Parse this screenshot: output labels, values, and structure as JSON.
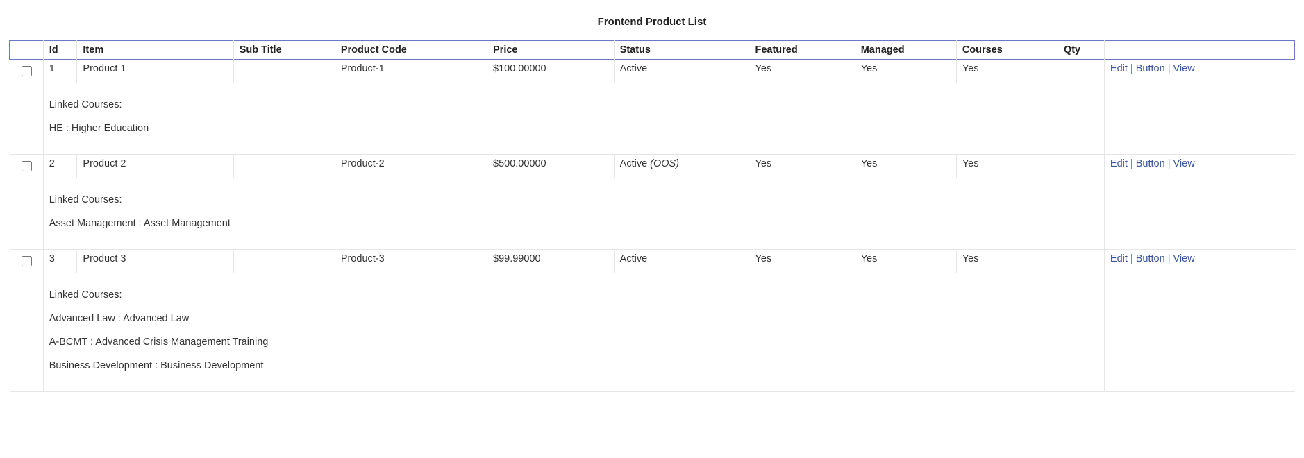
{
  "title": "Frontend Product List",
  "columns": {
    "checkbox": "",
    "id": "Id",
    "item": "Item",
    "sub_title": "Sub Title",
    "product_code": "Product Code",
    "price": "Price",
    "status": "Status",
    "featured": "Featured",
    "managed": "Managed",
    "courses": "Courses",
    "qty": "Qty",
    "actions": ""
  },
  "linked_label": "Linked Courses:",
  "actions": {
    "edit": "Edit",
    "button": "Button",
    "view": "View"
  },
  "rows": [
    {
      "id": "1",
      "item": "Product 1",
      "sub_title": "",
      "product_code": "Product-1",
      "price": "$100.00000",
      "status": "Active",
      "status_suffix": "",
      "featured": "Yes",
      "managed": "Yes",
      "courses": "Yes",
      "qty": "",
      "linked": [
        "HE : Higher Education"
      ]
    },
    {
      "id": "2",
      "item": "Product 2",
      "sub_title": "",
      "product_code": "Product-2",
      "price": "$500.00000",
      "status": "Active ",
      "status_suffix": "(OOS)",
      "featured": "Yes",
      "managed": "Yes",
      "courses": "Yes",
      "qty": "",
      "linked": [
        "Asset Management : Asset Management"
      ]
    },
    {
      "id": "3",
      "item": "Product 3",
      "sub_title": "",
      "product_code": "Product-3",
      "price": "$99.99000",
      "status": "Active",
      "status_suffix": "",
      "featured": "Yes",
      "managed": "Yes",
      "courses": "Yes",
      "qty": "",
      "linked": [
        "Advanced Law : Advanced Law",
        "A-BCMT : Advanced Crisis Management Training",
        "Business Development : Business Development"
      ]
    }
  ]
}
